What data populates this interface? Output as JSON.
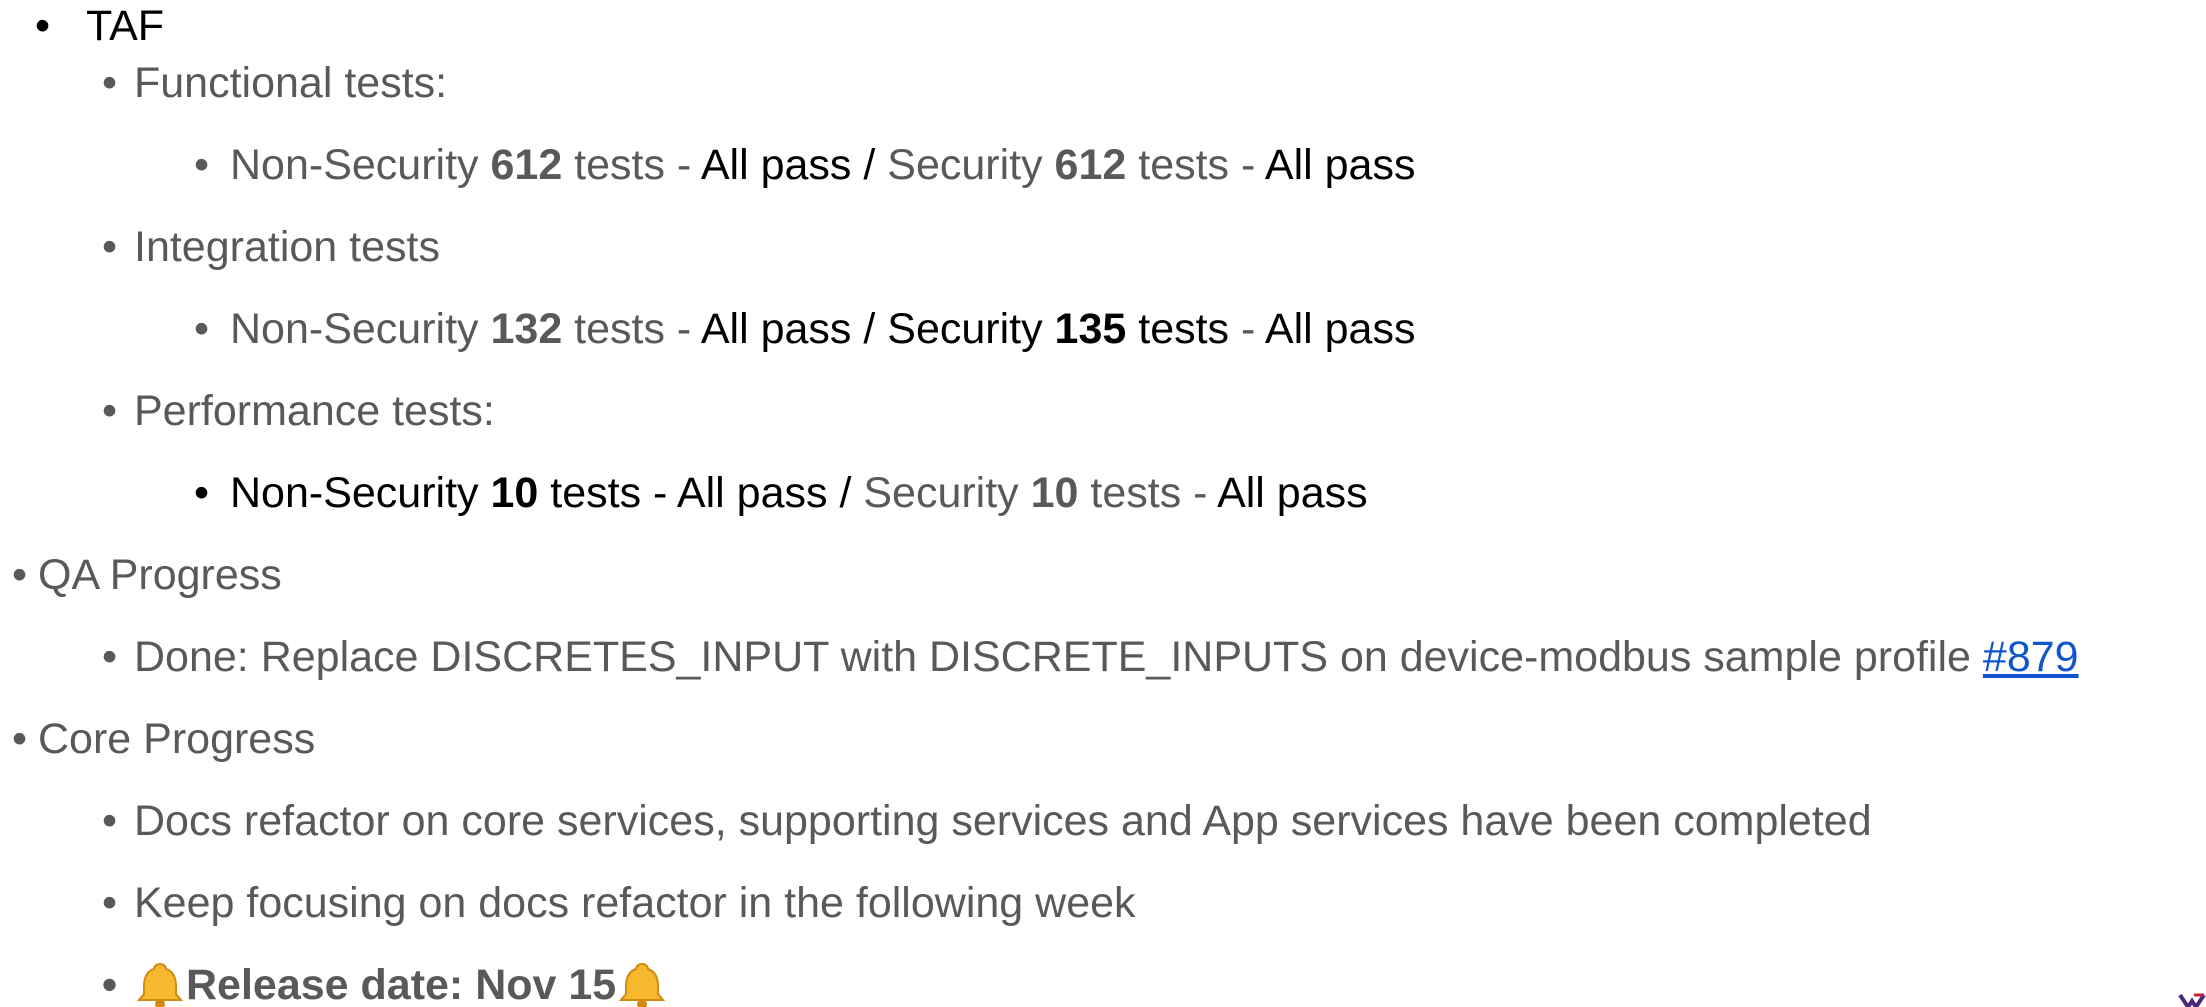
{
  "bullet": "•",
  "taf": {
    "label": "TAF",
    "functional": {
      "label": "Functional tests:",
      "detail": {
        "ns_prefix": "Non-Security ",
        "ns_count": "612",
        "ns_tests": " tests - ",
        "ns_result": "All pass",
        "sep": " / ",
        "s_prefix": "Security ",
        "s_count": "612",
        "s_tests": " tests - ",
        "s_result": "All pass"
      }
    },
    "integration": {
      "label": "Integration tests",
      "detail": {
        "ns_prefix": "Non-Security ",
        "ns_count": "132",
        "ns_tests": " tests - ",
        "ns_result": "All pass",
        "sep": " / ",
        "s_prefix": "Security ",
        "s_count": "135",
        "s_tests": " tests",
        "s_dash": " - ",
        "s_result": "All pass"
      }
    },
    "performance": {
      "label": "Performance tests:",
      "detail": {
        "ns_prefix": "Non-Security ",
        "ns_count": "10",
        "ns_tests": " tests  -  All pass",
        "sep": " / ",
        "s_prefix": "Security ",
        "s_count": "10",
        "s_tests": " tests -",
        "s_result": "  All pass"
      }
    }
  },
  "qa": {
    "label": "QA Progress",
    "done_text": "Done: Replace DISCRETES_INPUT with DISCRETE_INPUTS on device-modbus sample profile ",
    "done_link": "#879"
  },
  "core": {
    "label": "Core Progress",
    "items": [
      "Docs refactor on core services, supporting services and App services have been completed",
      "Keep focusing on docs refactor in the following week"
    ],
    "release": "Release date: Nov 15"
  },
  "colors": {
    "text_gray": "#595959",
    "text_black": "#000000",
    "link": "#1155cc",
    "bell": "#f5b82e"
  },
  "icons": {
    "bell": "bell-icon"
  }
}
